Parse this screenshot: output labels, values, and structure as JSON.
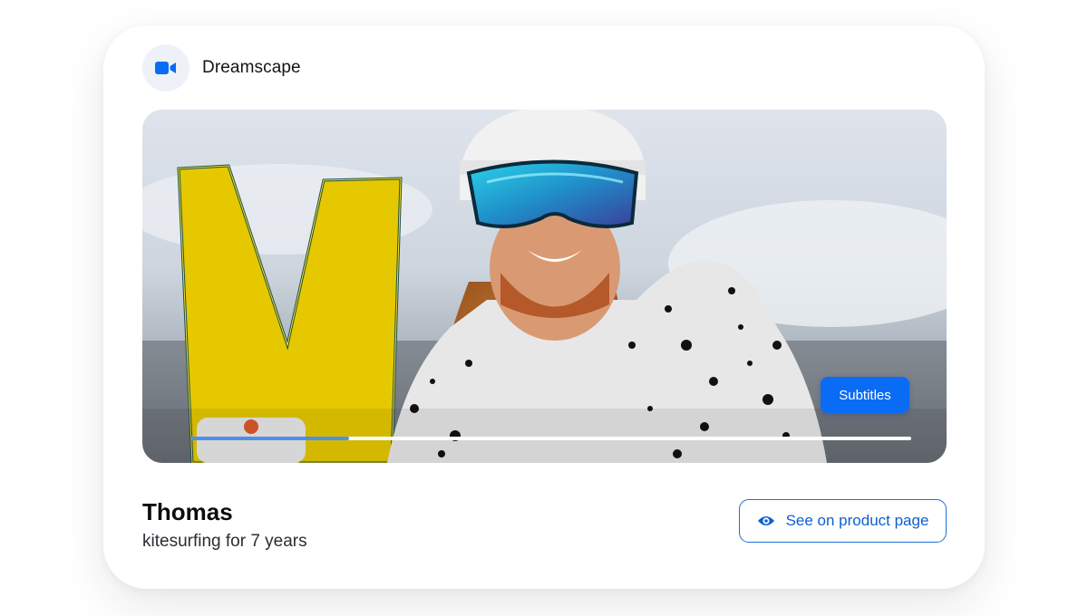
{
  "brand": {
    "name": "Dreamscape",
    "icon": "video-camera-icon",
    "accent": "#0a6cf5"
  },
  "video": {
    "subtitles_label": "Subtitles",
    "progress_fraction": 0.22
  },
  "profile": {
    "name": "Thomas",
    "tagline": "kitesurfing for 7 years"
  },
  "cta": {
    "label": "See on product page",
    "icon": "eye-icon"
  }
}
